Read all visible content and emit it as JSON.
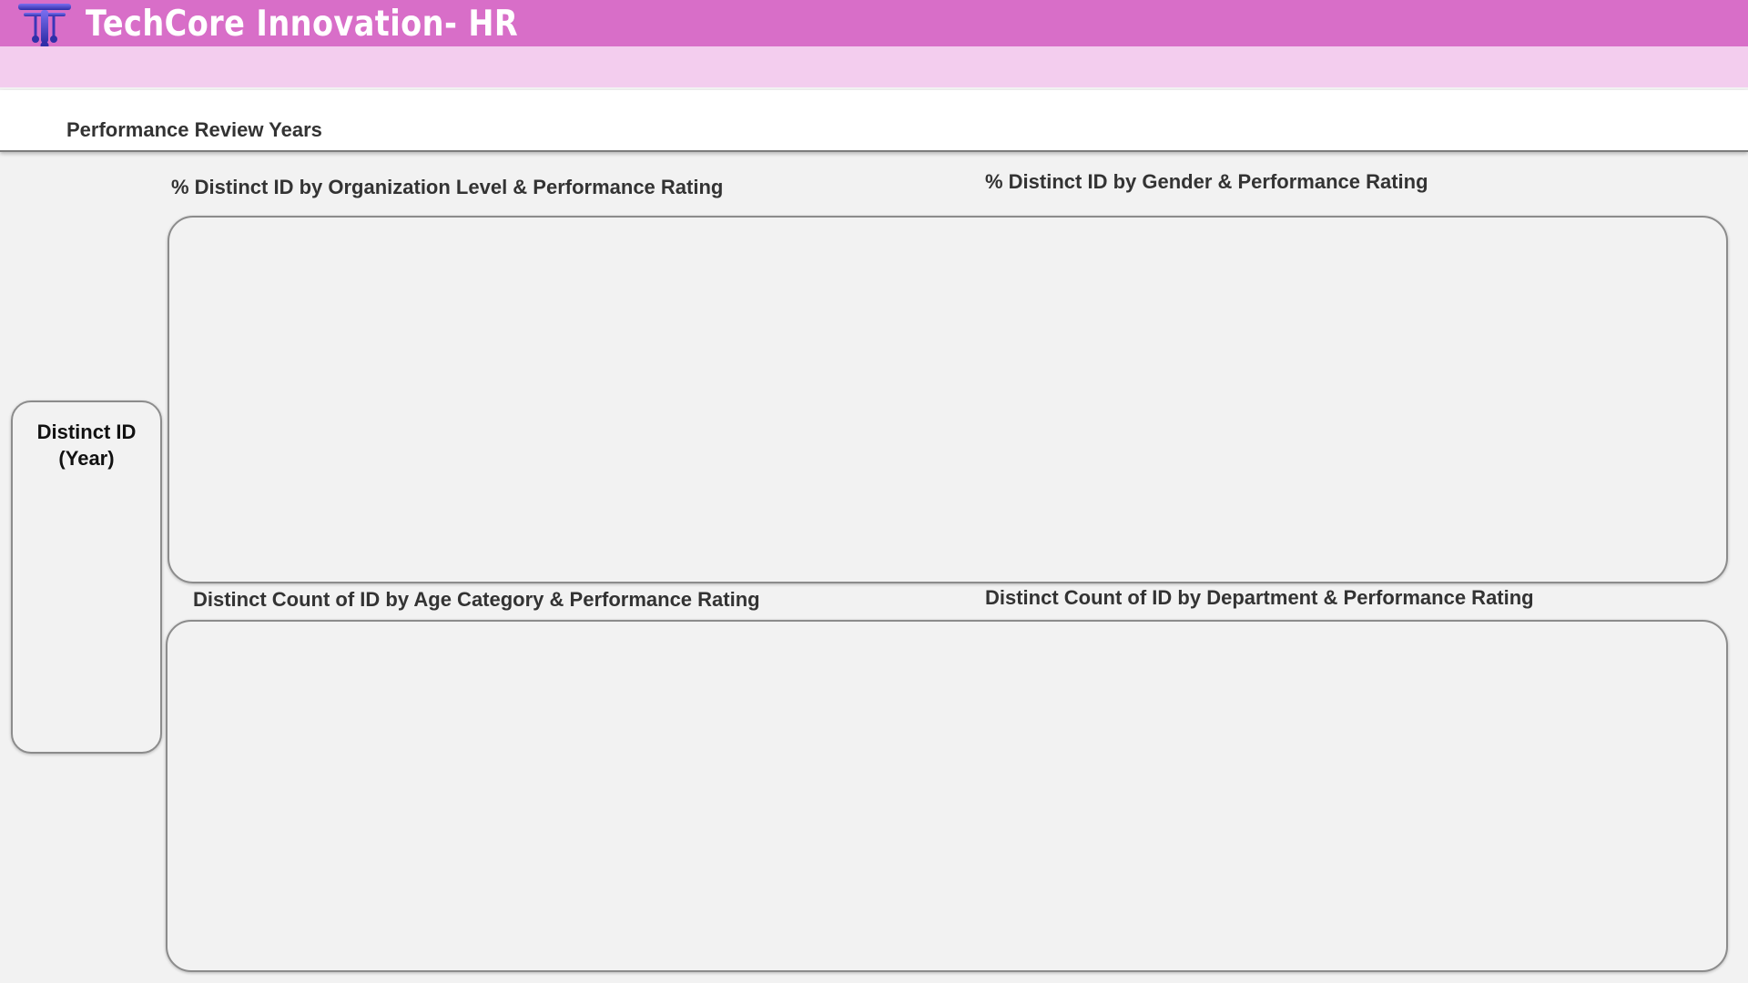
{
  "header": {
    "title": "TechCore Innovation- HR",
    "logo_icon": "t-circuit-logo-icon",
    "colors": {
      "band": "#d86ec8",
      "subband": "#f3cdee",
      "logo": "#5b4fd1"
    }
  },
  "slicer": {
    "label": "Performance Review Years"
  },
  "kpi": {
    "line1": "Distinct ID",
    "line2": "(Year)"
  },
  "charts": {
    "org_level": "% Distinct  ID by Organization Level & Performance Rating",
    "gender": "% Distinct ID by Gender & Performance Rating",
    "age": "Distinct Count of ID by Age Category & Performance Rating",
    "department": "Distinct Count of ID by Department & Performance Rating"
  },
  "background": "#f2f2f2"
}
